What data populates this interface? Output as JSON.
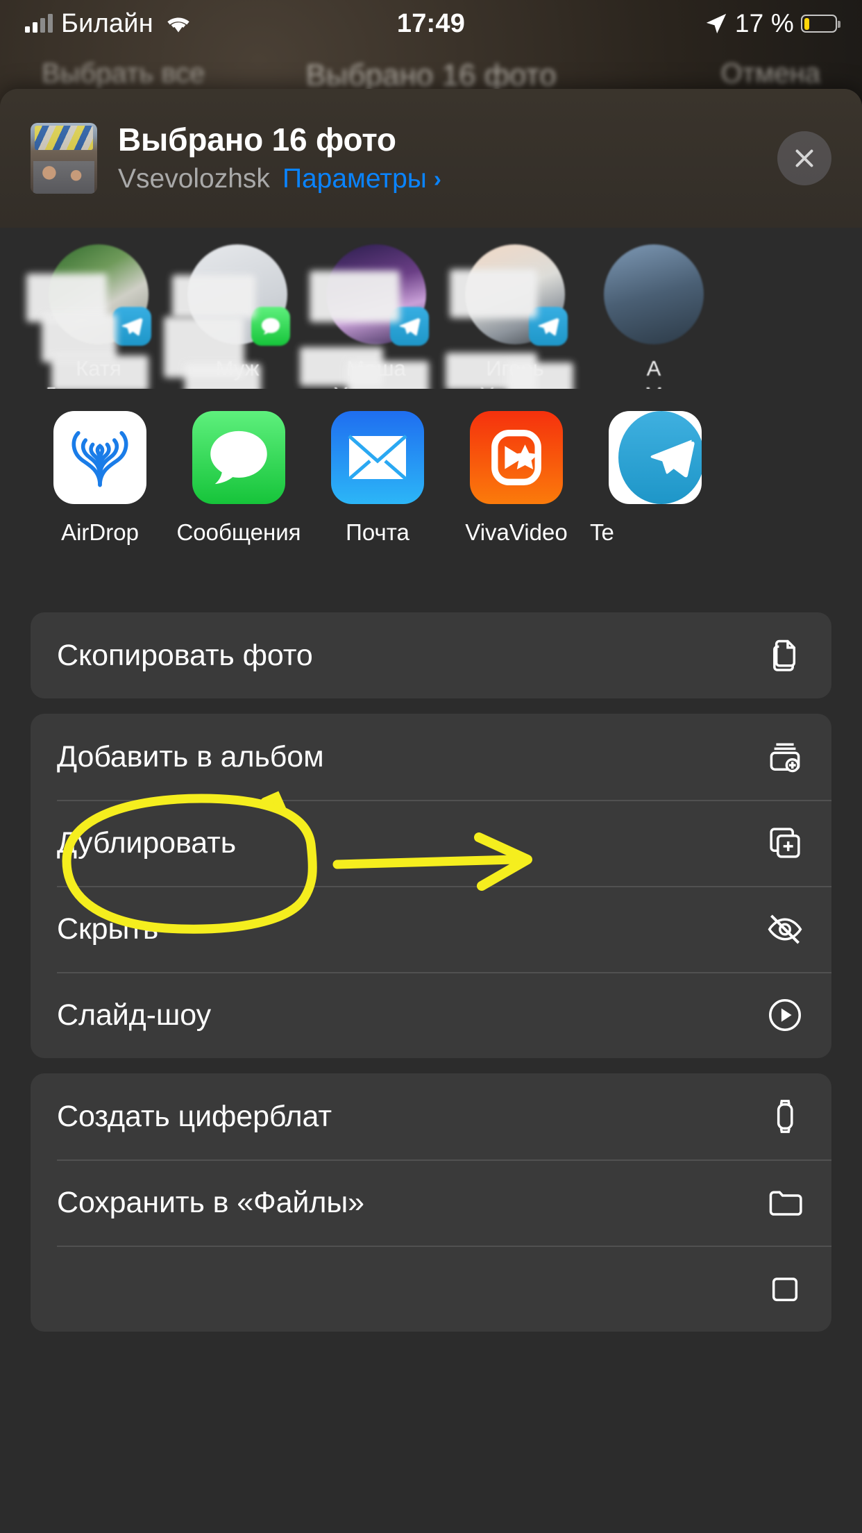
{
  "status_bar": {
    "carrier": "Билайн",
    "signal_icon": "cellular-bars-icon",
    "wifi_icon": "wifi-icon",
    "time": "17:49",
    "location_icon": "location-arrow-icon",
    "battery_percent": "17 %",
    "battery_icon": "battery-low-icon",
    "battery_fill_color": "#ffd60a"
  },
  "backdrop": {
    "select_all": "Выбрать все",
    "title": "Выбрано 16 фото",
    "cancel": "Отмена"
  },
  "sheet": {
    "header": {
      "thumbnail_icon": "photo-thumbnail",
      "title": "Выбрано 16 фото",
      "subtitle_name": "Vsevolozhsk",
      "options_label": "Параметры",
      "options_chevron_icon": "chevron-right-icon",
      "close_icon": "close-icon",
      "accent_color": "#0a84ff"
    },
    "contacts": [
      {
        "name_line1": "Катя",
        "name_line2": "Домрачева",
        "app_badge": "telegram-icon",
        "badge_color": "#37aee2"
      },
      {
        "name_line1": "Муж",
        "name_line2": "",
        "app_badge": "messages-icon",
        "badge_color": "#34c759"
      },
      {
        "name_line1": "Маша",
        "name_line2": "Ученица",
        "app_badge": "telegram-icon",
        "badge_color": "#37aee2"
      },
      {
        "name_line1": "Игорь",
        "name_line2": "Ученик",
        "app_badge": "telegram-icon",
        "badge_color": "#37aee2"
      },
      {
        "name_line1": "А",
        "name_line2": "М",
        "app_badge": "",
        "badge_color": ""
      }
    ],
    "apps": [
      {
        "label": "AirDrop",
        "icon": "airdrop-icon",
        "bg": "#ffffff"
      },
      {
        "label": "Сообщения",
        "icon": "messages-icon",
        "bg": "#34c759"
      },
      {
        "label": "Почта",
        "icon": "mail-icon",
        "bg": "#1d8cf8"
      },
      {
        "label": "VivaVideo",
        "icon": "vivavideo-icon",
        "bg": "#f94b0e"
      },
      {
        "label": "Te",
        "icon": "telegram-icon",
        "bg": "#2ea6da"
      }
    ],
    "action_groups": [
      {
        "rows": [
          {
            "label": "Скопировать фото",
            "icon": "copy-icon"
          }
        ]
      },
      {
        "rows": [
          {
            "label": "Добавить в альбом",
            "icon": "add-to-album-icon"
          },
          {
            "label": "Дублировать",
            "icon": "duplicate-icon"
          },
          {
            "label": "Скрыть",
            "icon": "eye-slash-icon"
          },
          {
            "label": "Слайд-шоу",
            "icon": "play-circle-icon"
          }
        ]
      },
      {
        "rows": [
          {
            "label": "Создать циферблат",
            "icon": "watch-face-icon"
          },
          {
            "label": "Сохранить в «Файлы»",
            "icon": "folder-icon"
          },
          {
            "label": "",
            "icon": "partial-icon"
          }
        ]
      }
    ]
  },
  "annotation": {
    "color": "#f5ee1e",
    "ellipse_target": "Слайд-шоу",
    "arrow_target": "play-circle-icon"
  }
}
